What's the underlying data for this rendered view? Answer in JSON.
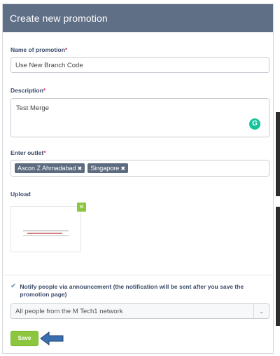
{
  "modal": {
    "title": "Create new promotion"
  },
  "form": {
    "name_label": "Name of promotion",
    "required_mark": "*",
    "name_value": "Use New Branch Code",
    "description_label": "Description",
    "description_value": "Test Merge",
    "outlet_label": "Enter outlet",
    "outlets": [
      {
        "label": "Ascon Z Ahmadabad",
        "remove": "✖"
      },
      {
        "label": "Singapore",
        "remove": "✖"
      }
    ],
    "upload_label": "Upload",
    "upload_remove": "✕",
    "notify_label": "Notify people via announcement (the notification will be sent after you save the promotion page)",
    "notify_checked": true,
    "audience_value": "All people from the M Tech1 network",
    "save_label": "Save"
  },
  "colors": {
    "header": "#5f6f86",
    "accent_green": "#8cc63f",
    "tag": "#5d6b80",
    "annotation_arrow": "#3a6fb0"
  },
  "icons": {
    "grammarly": "grammarly-icon",
    "checkbox": "checkmark-icon",
    "dropdown": "chevron-down-icon",
    "annotation": "arrow-left-icon"
  }
}
